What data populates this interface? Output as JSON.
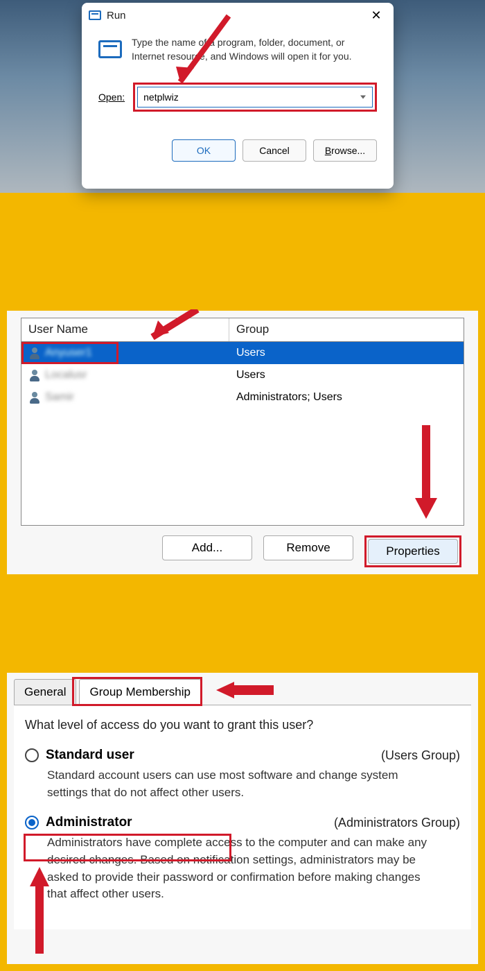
{
  "run": {
    "title": "Run",
    "message": "Type the name of a program, folder, document, or Internet resource, and Windows will open it for you.",
    "open_label": "Open:",
    "input_value": "netplwiz",
    "ok_label": "OK",
    "cancel_label": "Cancel",
    "browse_label": "Browse..."
  },
  "users_table": {
    "col_user": "User Name",
    "col_group": "Group",
    "rows": [
      {
        "name": "Anyuser1",
        "group": "Users",
        "selected": true
      },
      {
        "name": "Localusr",
        "group": "Users",
        "selected": false
      },
      {
        "name": "Samir",
        "group": "Administrators; Users",
        "selected": false
      }
    ],
    "add_label": "Add...",
    "remove_label": "Remove",
    "properties_label": "Properties"
  },
  "membership": {
    "tab_general": "General",
    "tab_group": "Group Membership",
    "question": "What level of access do you want to grant this user?",
    "standard": {
      "name": "Standard user",
      "group": "(Users Group)",
      "desc": "Standard account users can use most software and change system settings that do not affect other users."
    },
    "admin": {
      "name": "Administrator",
      "group": "(Administrators Group)",
      "desc": "Administrators have complete access to the computer and can make any desired changes. Based on notification settings, administrators may be asked to provide their password or confirmation before making changes that affect other users."
    }
  }
}
